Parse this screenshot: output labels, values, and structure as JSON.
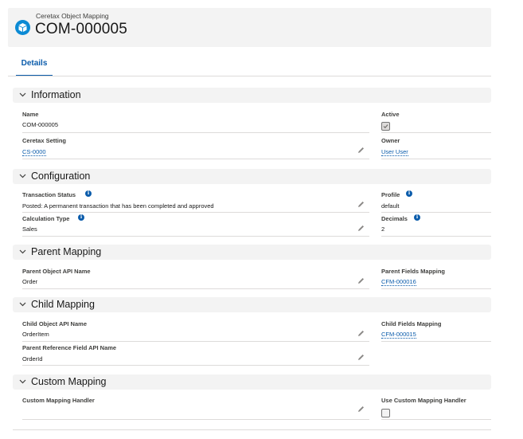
{
  "header": {
    "object_type": "Ceretax Object Mapping",
    "record_name": "COM-000005"
  },
  "tabs": [
    {
      "label": "Details"
    }
  ],
  "sections": {
    "information": {
      "title": "Information",
      "name_label": "Name",
      "name_value": "COM-000005",
      "active_label": "Active",
      "active_checked": true,
      "setting_label": "Ceretax Setting",
      "setting_value": "CS-0000",
      "owner_label": "Owner",
      "owner_value": "User User"
    },
    "configuration": {
      "title": "Configuration",
      "status_label": "Transaction Status",
      "status_value": "Posted: A permanent transaction that has been completed and approved",
      "profile_label": "Profile",
      "profile_value": "default",
      "calc_label": "Calculation Type",
      "calc_value": "Sales",
      "decimals_label": "Decimals",
      "decimals_value": "2"
    },
    "parent_mapping": {
      "title": "Parent Mapping",
      "api_label": "Parent Object API Name",
      "api_value": "Order",
      "fields_label": "Parent Fields Mapping",
      "fields_value": "CFM-000016"
    },
    "child_mapping": {
      "title": "Child Mapping",
      "api_label": "Child Object API Name",
      "api_value": "OrderItem",
      "fields_label": "Child Fields Mapping",
      "fields_value": "CFM-000015",
      "ref_label": "Parent Reference Field API Name",
      "ref_value": "OrderId"
    },
    "custom_mapping": {
      "title": "Custom Mapping",
      "handler_label": "Custom Mapping Handler",
      "handler_value": "",
      "use_label": "Use Custom Mapping Handler",
      "use_checked": false
    }
  },
  "icons": {
    "object": "cube-icon",
    "edit": "pencil-icon",
    "collapse": "chevron-down-icon",
    "help": "info-icon"
  },
  "colors": {
    "brand": "#0b5cab",
    "icon_bg": "#0b8ad4",
    "section_bg": "#f3f3f3"
  }
}
